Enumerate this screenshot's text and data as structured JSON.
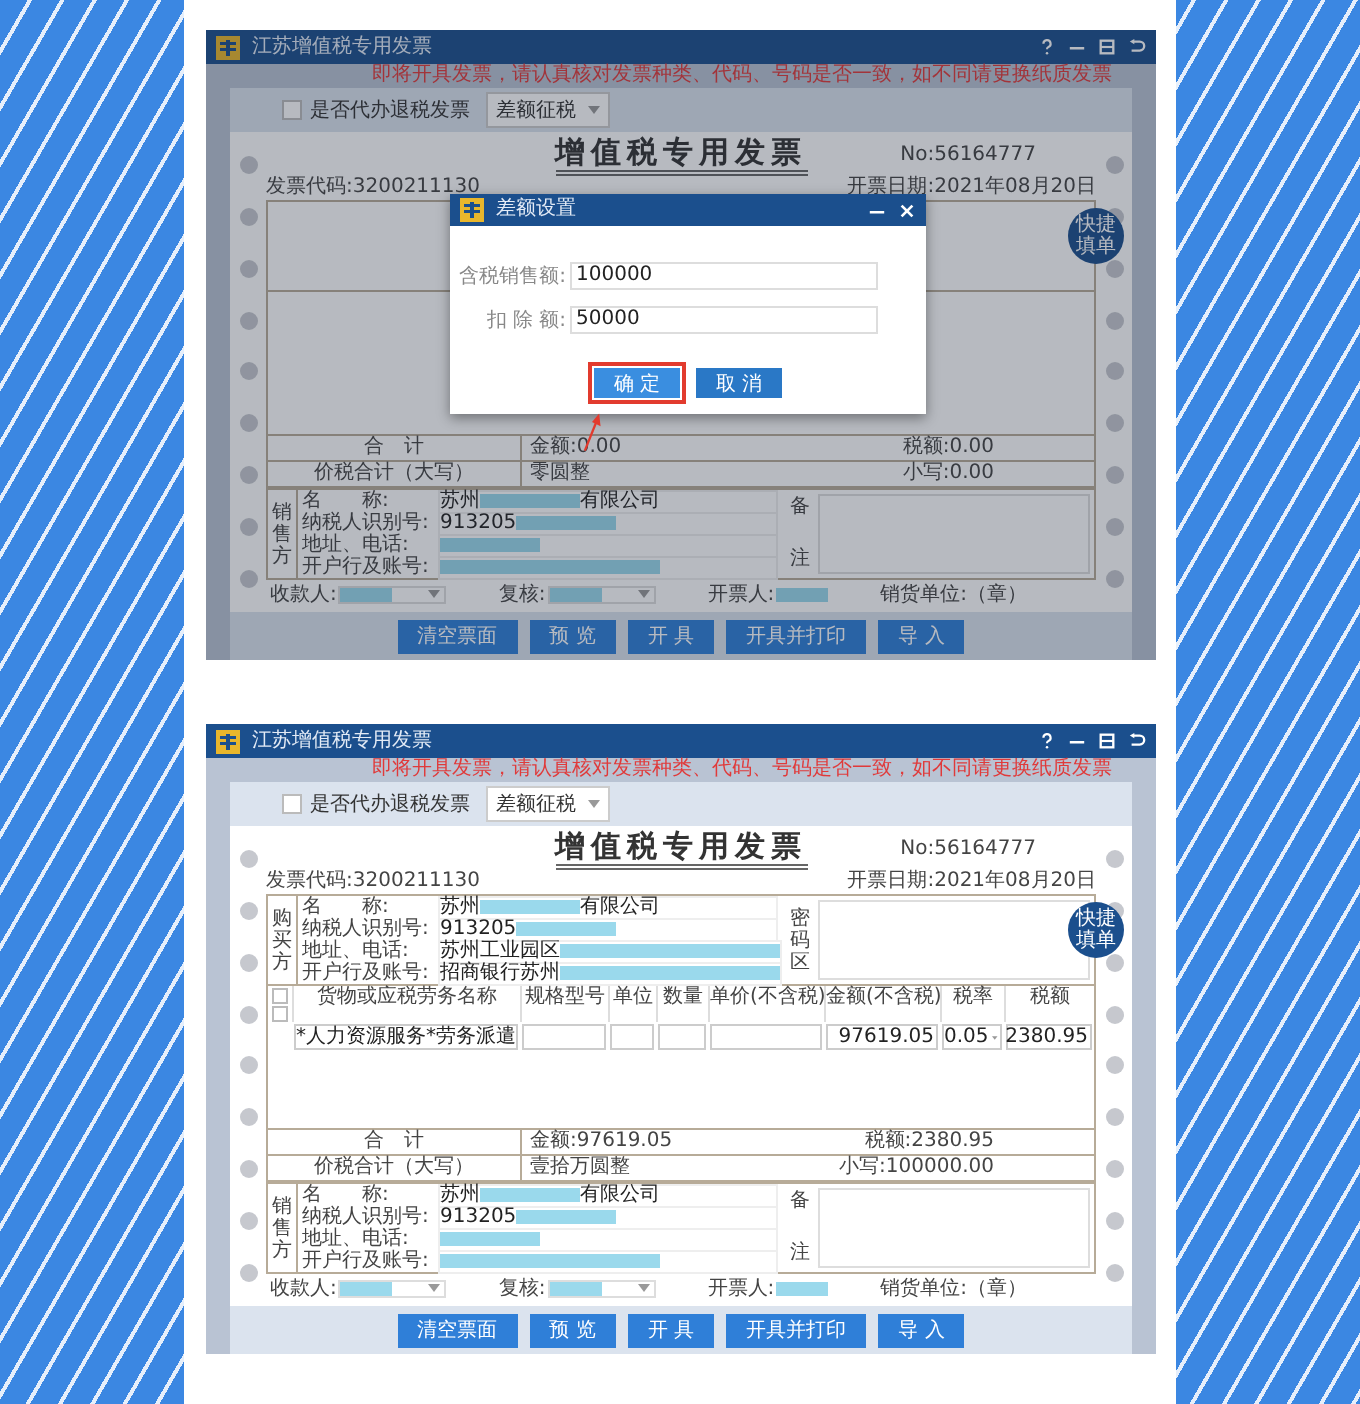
{
  "screens": [
    {
      "window_title": "江苏增值税专用发票",
      "notice": "即将开具发票，请认真核对发票种类、代码、号码是否一致，如不同请更换纸质发票",
      "refund_checkbox": {
        "label": "是否代办退税发票",
        "checked": false
      },
      "tax_mode": "差额征税",
      "invoice": {
        "title": "增值税专用发票",
        "number": "No:56164777",
        "code": "发票代码:3200211130",
        "date": "开票日期:2021年08月20日",
        "quick_fill": "快捷填单",
        "totals": {
          "label": "合　计",
          "amount": "金额:0.00",
          "tax": "税额:0.00"
        },
        "grand_total": {
          "label": "价税合计（大写）",
          "words": "零圆整",
          "figures": "小写:0.00"
        },
        "seller": {
          "side_label": "销售方",
          "remarks_label": "备注",
          "fields": [
            {
              "label": "名　　称:",
              "value": "苏州",
              "redacted": true,
              "suffix": "有限公司"
            },
            {
              "label": "纳税人识别号:",
              "value": "913205",
              "redacted": true
            },
            {
              "label": "地址、电话:",
              "redacted": true
            },
            {
              "label": "开户行及账号:",
              "redacted": true
            }
          ]
        },
        "footer": [
          {
            "label": "收款人:",
            "redacted": true,
            "kind": "select"
          },
          {
            "label": "复核:",
            "redacted": true,
            "kind": "select"
          },
          {
            "label": "开票人:",
            "redacted": true,
            "kind": "text"
          },
          {
            "label": "销货单位:（章）",
            "kind": "text"
          }
        ]
      },
      "buttons": [
        "清空票面",
        "预 览",
        "开 具",
        "开具并打印",
        "导 入"
      ],
      "dialog": {
        "title": "差额设置",
        "fields": [
          {
            "label": "含税销售额:",
            "value": "100000"
          },
          {
            "label": "扣 除 额:",
            "value": "50000"
          }
        ],
        "buttons": [
          {
            "label": "确 定",
            "highlighted": true
          },
          {
            "label": "取 消",
            "highlighted": false
          }
        ]
      }
    },
    {
      "window_title": "江苏增值税专用发票",
      "notice": "即将开具发票，请认真核对发票种类、代码、号码是否一致，如不同请更换纸质发票",
      "refund_checkbox": {
        "label": "是否代办退税发票",
        "checked": false
      },
      "tax_mode": "差额征税",
      "invoice": {
        "title": "增值税专用发票",
        "number": "No:56164777",
        "code": "发票代码:3200211130",
        "date": "开票日期:2021年08月20日",
        "quick_fill": "快捷填单",
        "buyer": {
          "side_label": "购买方",
          "cipher_label": "密码区",
          "fields": [
            {
              "label": "名　　称:",
              "value": "苏州",
              "redacted": true,
              "suffix": "有限公司"
            },
            {
              "label": "纳税人识别号:",
              "value": "913205",
              "redacted": true
            },
            {
              "label": "地址、电话:",
              "value": "苏州工业园区",
              "redacted": true
            },
            {
              "label": "开户行及账号:",
              "value": "招商银行苏州",
              "redacted": true
            }
          ]
        },
        "items": {
          "columns": [
            "货物或应税劳务名称",
            "规格型号",
            "单位",
            "数量",
            "单价(不含税)",
            "金额(不含税)",
            "税率",
            "税额"
          ],
          "rows": [
            {
              "name": "*人力资源服务*劳务派遣",
              "amount": "97619.05",
              "tax_rate": "0.05",
              "tax": "2380.95"
            }
          ]
        },
        "totals": {
          "label": "合　计",
          "amount": "金额:97619.05",
          "tax": "税额:2380.95"
        },
        "grand_total": {
          "label": "价税合计（大写）",
          "words": "壹拾万圆整",
          "figures": "小写:100000.00"
        },
        "seller": {
          "side_label": "销售方",
          "remarks_label": "备注",
          "fields": [
            {
              "label": "名　　称:",
              "value": "苏州",
              "redacted": true,
              "suffix": "有限公司"
            },
            {
              "label": "纳税人识别号:",
              "value": "913205",
              "redacted": true
            },
            {
              "label": "地址、电话:",
              "redacted": true
            },
            {
              "label": "开户行及账号:",
              "redacted": true
            }
          ]
        },
        "footer": [
          {
            "label": "收款人:",
            "redacted": true,
            "kind": "select"
          },
          {
            "label": "复核:",
            "redacted": true,
            "kind": "select"
          },
          {
            "label": "开票人:",
            "redacted": true,
            "kind": "text"
          },
          {
            "label": "销货单位:（章）",
            "kind": "text"
          }
        ]
      },
      "buttons": [
        "清空票面",
        "预 览",
        "开 具",
        "开具并打印",
        "导 入"
      ]
    }
  ]
}
